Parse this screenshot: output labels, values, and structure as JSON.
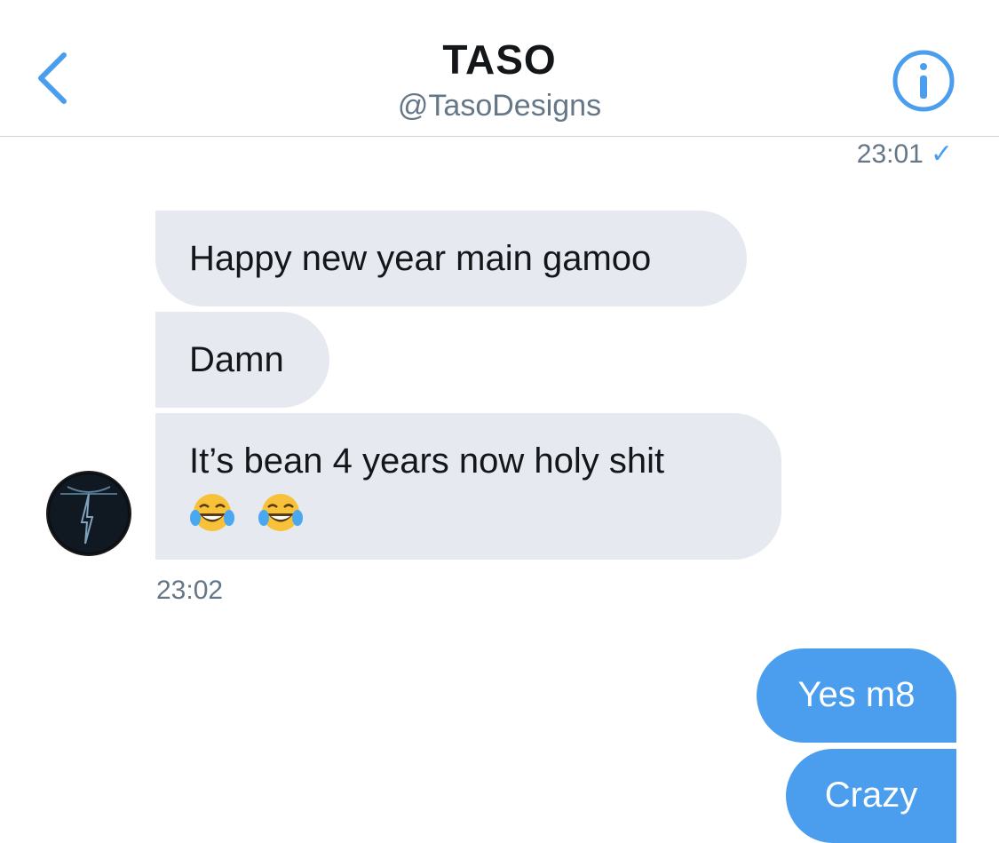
{
  "header": {
    "title": "TASO",
    "handle": "@TasoDesigns",
    "back_icon": "chevron-left-icon",
    "info_icon": "info-icon"
  },
  "colors": {
    "accent": "#4a9eed",
    "incoming_bubble": "#e6e9ef",
    "text_primary": "#14171a",
    "text_secondary": "#657786"
  },
  "conversation": {
    "sent_timestamp_top": "23:01",
    "sent_status_icon": "checkmark-icon",
    "incoming": [
      {
        "text": "Happy new year main gamoo"
      },
      {
        "text": "Damn"
      },
      {
        "text": "It’s bean 4 years now holy shit",
        "emoji": [
          "tears-of-joy-emoji",
          "tears-of-joy-emoji"
        ]
      }
    ],
    "incoming_timestamp": "23:02",
    "avatar_letter": "T",
    "outgoing": [
      {
        "text": "Yes m8"
      },
      {
        "text": "Crazy"
      }
    ]
  }
}
